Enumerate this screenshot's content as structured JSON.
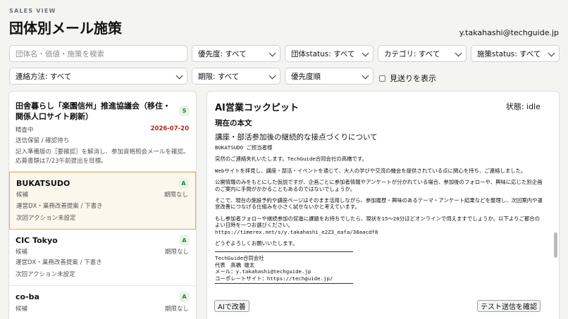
{
  "header": {
    "eyebrow": "SALES VIEW",
    "title": "団体別メール施策",
    "user_email": "y.takahashi@techguide.jp"
  },
  "filters": {
    "search_placeholder": "団体名・価値・施策を検索",
    "priority": "優先度: すべて",
    "org_status": "団体status: すべて",
    "category": "カテゴリ: すべて",
    "measure_status": "施策status: すべて",
    "contact_method": "連絡方法: すべて",
    "deadline": "期限: すべて",
    "sort": "優先度順",
    "show_declined_label": "見送りを表示"
  },
  "list": [
    {
      "name": "田舎暮らし「楽園信州」推進協議会（移住・関係人口サイト刷新）",
      "badge": "S",
      "status": "精査中",
      "date": "2026-07-20",
      "note": "送信保留 / 確認待ち",
      "hint": "記入準備版の［要確認］を解消し、参加資格照会メールを確認。応募書類は7/23午前提出を目標。"
    },
    {
      "name": "BUKATSUDO",
      "badge": "A",
      "status": "候補",
      "date": "期限なし",
      "note": "運営DX・業務改善提案 / 下書き",
      "hint": "次回アクション未設定"
    },
    {
      "name": "CIC Tokyo",
      "badge": "A",
      "status": "候補",
      "date": "期限なし",
      "note": "運営DX・業務改善提案 / 下書き",
      "hint": "次回アクション未設定"
    },
    {
      "name": "co-ba",
      "badge": "A",
      "status": "候補",
      "date": "期限なし"
    }
  ],
  "panel": {
    "title": "AI営業コックピット",
    "state": "状態: idle",
    "section": "現在の本文",
    "subject": "講座・部活参加後の継続的な接点づくりについて",
    "body": [
      "BUKATSUDO ご担当者様",
      "突然のご連絡失礼いたします。TechGuide合同会社の高橋です。",
      "Webサイトを拝見し、講座・部活・イベントを通じて、大人の学びや交流の機会を提供されている点に関心を持ち、ご連絡しました。",
      "公開情報のみをもとにした仮説ですが、企画ごとに参加者情報やアンケートが分かれている場合、参加後のフォローや、興味に応じた別企画のご案内に手間がかかることもあるのではないでしょうか。",
      "そこで、現在の施設予約や講座ページはそのまま活用しながら、参加履歴・興味のあるテーマ・アンケート結果などを整理し、次回案内や運営改善につなげる仕組みを小さく試せないかと考えています。",
      "もし参加者フォローや継続参加の促進に課題をお持ちでしたら、現状を15〜20分ほどオンラインで伺えますでしょうか。以下よりご都合のよい日時を一つお選びください。\nhttps://timerex.net/s/y.takahashi_e2Z3_eafa/38aacdf8",
      "どうぞよろしくお願いいたします。"
    ],
    "signature": [
      "TechGuide合同会社",
      "代表　高橋 雄太",
      "メール：y.takahashi@techguide.jp",
      "コーポレートサイト：https://techguide.jp/"
    ],
    "ai_button": "AIで改善",
    "test_button": "テスト送信を確認"
  }
}
